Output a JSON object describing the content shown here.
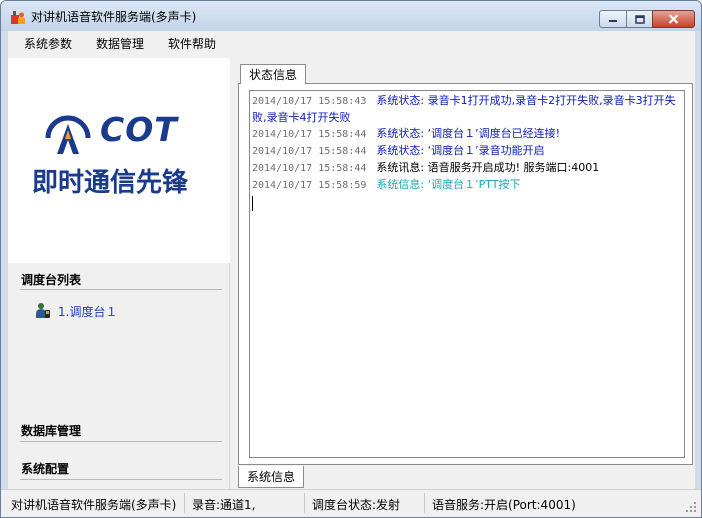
{
  "window": {
    "title": "对讲机语音软件服务端(多声卡)",
    "icons": {
      "app": "app-icon",
      "minimize": "minimize-icon",
      "maximize": "maximize-icon",
      "close": "close-icon"
    }
  },
  "menu": {
    "items": [
      "系统参数",
      "数据管理",
      "软件帮助"
    ]
  },
  "sidebar": {
    "logo": {
      "brand": "COT",
      "slogan": "即时通信先锋",
      "color": "#1a3a8c"
    },
    "station_list_header": "调度台列表",
    "stations": [
      {
        "label": "1.调度台１",
        "icon": "dispatcher-icon"
      }
    ],
    "database_header": "数据库管理",
    "config_header": "系统配置"
  },
  "main": {
    "top_tab": "状态信息",
    "bottom_tab": "系统信息",
    "log": [
      {
        "time": "2014/10/17 15:58:43",
        "text": "系统状态: 录音卡1打开成功,录音卡2打开失败,录音卡3打开失败,录音卡4打开失败",
        "color": "#0b1bb8"
      },
      {
        "time": "2014/10/17 15:58:44",
        "text": "系统状态: ‘调度台１’调度台已经连接!",
        "color": "#0b1bb8"
      },
      {
        "time": "2014/10/17 15:58:44",
        "text": "系统状态: ‘调度台１’录音功能开启",
        "color": "#0b1bb8"
      },
      {
        "time": "2014/10/17 15:58:44",
        "text": "系统讯息: 语音服务开启成功! 服务端口:4001",
        "color": "#000000"
      },
      {
        "time": "2014/10/17 15:58:59",
        "text": "系统信息: ‘调度台１’PTT按下",
        "color": "#1aa8b8"
      }
    ]
  },
  "statusbar": {
    "app_name": "对讲机语音软件服务端(多声卡)",
    "recording": "录音:通道1,",
    "station_status": "调度台状态:发射",
    "voice_service": "语音服务:开启(Port:4001)"
  }
}
